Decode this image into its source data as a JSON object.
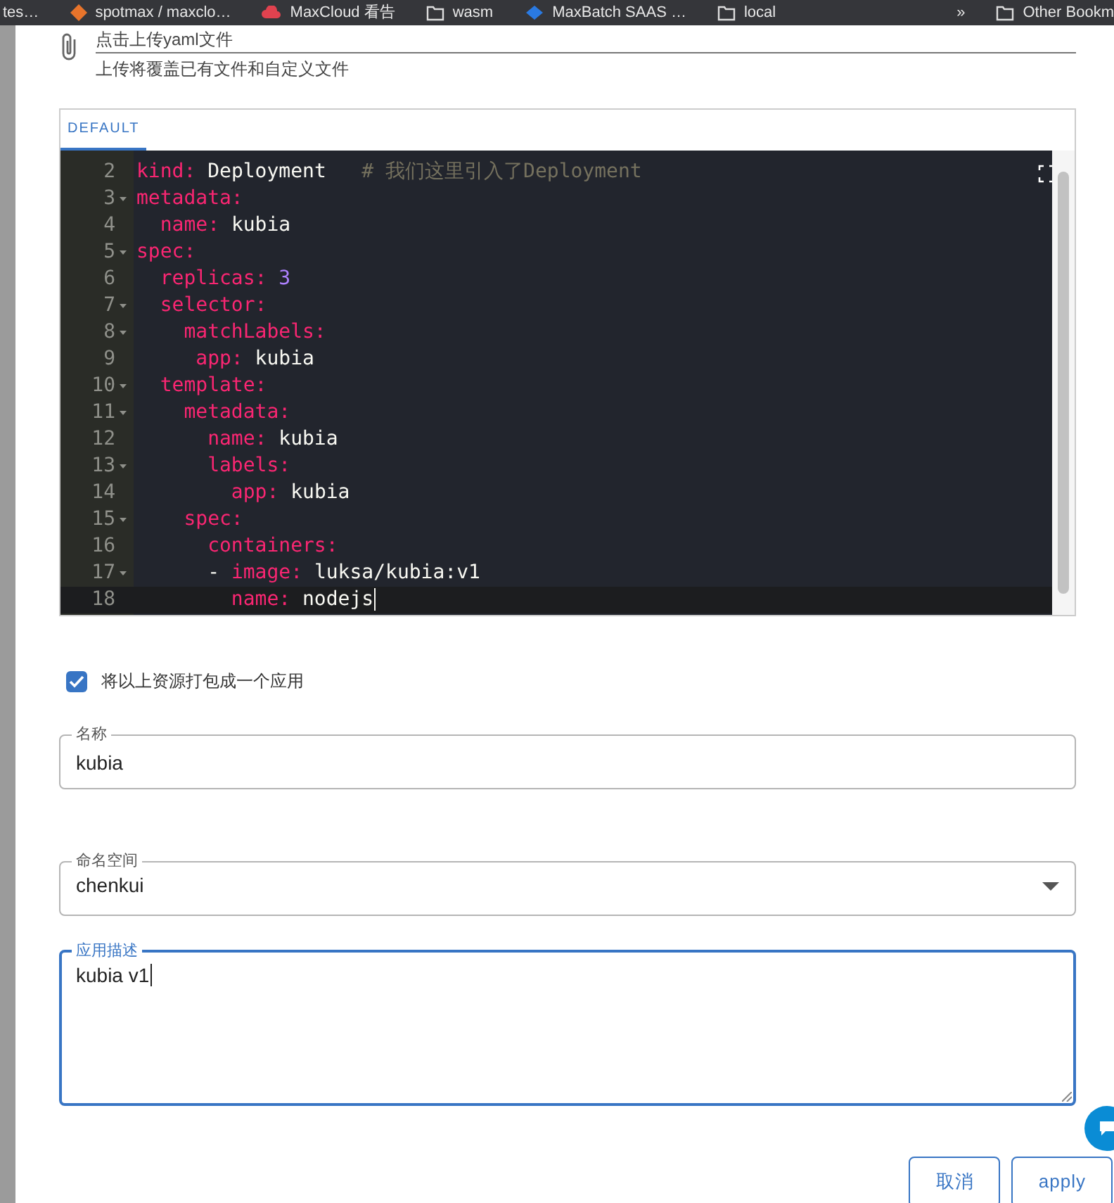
{
  "bookmarks_bar": {
    "items": [
      {
        "label": "tes…"
      },
      {
        "label": "spotmax / maxclo…"
      },
      {
        "label": "MaxCloud 看告"
      },
      {
        "label": "wasm"
      },
      {
        "label": "MaxBatch SAAS …"
      },
      {
        "label": "local"
      }
    ],
    "overflow": "»",
    "other": "Other Bookm"
  },
  "upload": {
    "label": "点击上传yaml文件",
    "helper": "上传将覆盖已有文件和自定义文件"
  },
  "editor": {
    "tabs": [
      {
        "label": "DEFAULT",
        "selected": true
      }
    ],
    "lines": [
      {
        "number": "2",
        "foldable": false,
        "current": false,
        "tokens": [
          {
            "kind": "key",
            "text": "kind:"
          },
          {
            "kind": "text",
            "text": " Deployment   "
          },
          {
            "kind": "comment",
            "text": "# 我们这里引入了Deployment"
          }
        ]
      },
      {
        "number": "3",
        "foldable": true,
        "current": false,
        "tokens": [
          {
            "kind": "key",
            "text": "metadata:"
          }
        ]
      },
      {
        "number": "4",
        "foldable": false,
        "current": false,
        "tokens": [
          {
            "kind": "key",
            "text": "  name:"
          },
          {
            "kind": "text",
            "text": " kubia"
          }
        ]
      },
      {
        "number": "5",
        "foldable": true,
        "current": false,
        "tokens": [
          {
            "kind": "key",
            "text": "spec:"
          }
        ]
      },
      {
        "number": "6",
        "foldable": false,
        "current": false,
        "tokens": [
          {
            "kind": "key",
            "text": "  replicas:"
          },
          {
            "kind": "number",
            "text": " 3"
          }
        ]
      },
      {
        "number": "7",
        "foldable": true,
        "current": false,
        "tokens": [
          {
            "kind": "key",
            "text": "  selector:"
          }
        ]
      },
      {
        "number": "8",
        "foldable": true,
        "current": false,
        "tokens": [
          {
            "kind": "key",
            "text": "    matchLabels:"
          }
        ]
      },
      {
        "number": "9",
        "foldable": false,
        "current": false,
        "tokens": [
          {
            "kind": "key",
            "text": "     app:"
          },
          {
            "kind": "text",
            "text": " kubia"
          }
        ]
      },
      {
        "number": "10",
        "foldable": true,
        "current": false,
        "tokens": [
          {
            "kind": "key",
            "text": "  template:"
          }
        ]
      },
      {
        "number": "11",
        "foldable": true,
        "current": false,
        "tokens": [
          {
            "kind": "key",
            "text": "    metadata:"
          }
        ]
      },
      {
        "number": "12",
        "foldable": false,
        "current": false,
        "tokens": [
          {
            "kind": "key",
            "text": "      name:"
          },
          {
            "kind": "text",
            "text": " kubia"
          }
        ]
      },
      {
        "number": "13",
        "foldable": true,
        "current": false,
        "tokens": [
          {
            "kind": "key",
            "text": "      labels:"
          }
        ]
      },
      {
        "number": "14",
        "foldable": false,
        "current": false,
        "tokens": [
          {
            "kind": "key",
            "text": "        app:"
          },
          {
            "kind": "text",
            "text": " kubia"
          }
        ]
      },
      {
        "number": "15",
        "foldable": true,
        "current": false,
        "tokens": [
          {
            "kind": "key",
            "text": "    spec:"
          }
        ]
      },
      {
        "number": "16",
        "foldable": false,
        "current": false,
        "tokens": [
          {
            "kind": "key",
            "text": "      containers:"
          }
        ]
      },
      {
        "number": "17",
        "foldable": true,
        "current": false,
        "tokens": [
          {
            "kind": "text",
            "text": "      - "
          },
          {
            "kind": "key",
            "text": "image:"
          },
          {
            "kind": "text",
            "text": " luksa/kubia:v1"
          }
        ]
      },
      {
        "number": "18",
        "foldable": false,
        "current": true,
        "tokens": [
          {
            "kind": "key",
            "text": "        name:"
          },
          {
            "kind": "text",
            "text": " nodejs"
          }
        ]
      }
    ]
  },
  "package_option": {
    "label": "将以上资源打包成一个应用",
    "checked": true
  },
  "fields": [
    {
      "kind": "text",
      "label": "名称",
      "value": "kubia",
      "focused": false
    },
    {
      "kind": "select",
      "label": "命名空间",
      "value": "chenkui",
      "focused": false
    },
    {
      "kind": "textarea",
      "label": "应用描述",
      "value": "kubia v1",
      "focused": true
    }
  ],
  "buttons": [
    "取消",
    "apply"
  ]
}
